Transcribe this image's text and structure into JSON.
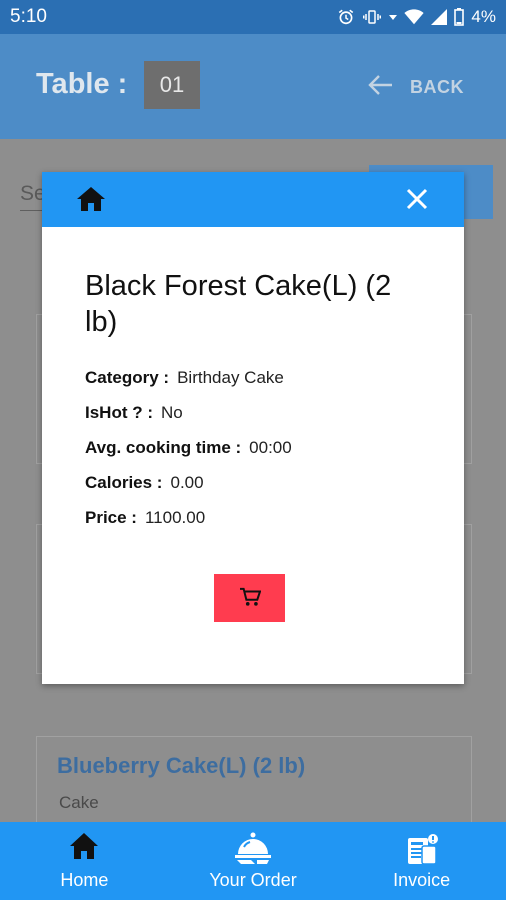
{
  "status_bar": {
    "time": "5:10",
    "battery": "4%"
  },
  "header": {
    "table_label": "Table :",
    "table_number": "01",
    "back_label": "BACK"
  },
  "search": {
    "placeholder_partial": "Se"
  },
  "background_items": [
    {
      "title": "Blueberry Cake(L) (2 lb)",
      "subtitle": "Cake"
    }
  ],
  "dialog": {
    "title": "Black Forest Cake(L) (2 lb)",
    "fields": [
      {
        "label": "Category :",
        "value": "Birthday Cake"
      },
      {
        "label": "IsHot ? :",
        "value": "No"
      },
      {
        "label": "Avg. cooking time :",
        "value": "00:00"
      },
      {
        "label": "Calories :",
        "value": "0.00"
      },
      {
        "label": "Price :",
        "value": "1100.00"
      }
    ]
  },
  "bottom_nav": {
    "items": [
      {
        "label": "Home",
        "icon": "home-icon"
      },
      {
        "label": "Your Order",
        "icon": "food-tray-icon"
      },
      {
        "label": "Invoice",
        "icon": "invoice-icon"
      }
    ]
  },
  "colors": {
    "primary": "#2196f3",
    "cart_button": "#ff3c4f",
    "status_bar": "#2b6fb3"
  }
}
